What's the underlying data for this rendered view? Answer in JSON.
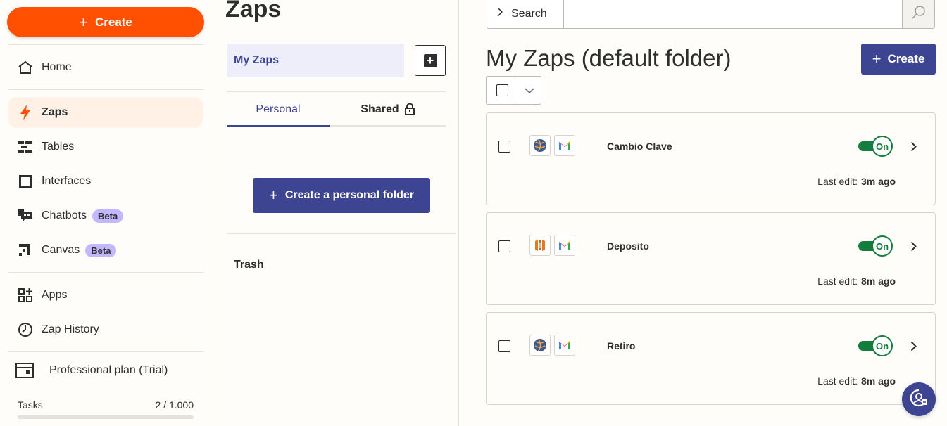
{
  "sidebar": {
    "create_label": "Create",
    "nav_primary": [
      {
        "label": "Home",
        "icon": "home-icon"
      }
    ],
    "nav_main": [
      {
        "label": "Zaps",
        "icon": "bolt-icon",
        "active": true
      },
      {
        "label": "Tables",
        "icon": "tables-icon"
      },
      {
        "label": "Interfaces",
        "icon": "interfaces-icon"
      },
      {
        "label": "Chatbots",
        "icon": "chatbot-icon",
        "badge": "Beta"
      },
      {
        "label": "Canvas",
        "icon": "canvas-icon",
        "badge": "Beta"
      }
    ],
    "nav_secondary": [
      {
        "label": "Apps",
        "icon": "apps-icon"
      },
      {
        "label": "Zap History",
        "icon": "history-icon"
      }
    ],
    "plan_label": "Professional plan (Trial)",
    "tasks_label": "Tasks",
    "tasks_value": "2 / 1.000",
    "tasks_fraction": 0.002
  },
  "folders": {
    "title": "Zaps",
    "my_zaps_label": "My Zaps",
    "tabs": [
      {
        "label": "Personal",
        "active": true
      },
      {
        "label": "Shared",
        "icon": "lock-icon"
      }
    ],
    "create_folder_label": "Create a personal folder",
    "trash_label": "Trash"
  },
  "main": {
    "search_scope_label": "Search",
    "search_value": "",
    "title": "My Zaps (default folder)",
    "create_label": "Create",
    "zaps": [
      {
        "name": "Cambio Clave",
        "apps": [
          "globe-app-icon",
          "gmail-icon"
        ],
        "status": "On",
        "last_edit_label": "Last edit:",
        "last_edit_value": "3m ago"
      },
      {
        "name": "Deposito",
        "apps": [
          "aws-app-icon",
          "gmail-icon"
        ],
        "status": "On",
        "last_edit_label": "Last edit:",
        "last_edit_value": "8m ago"
      },
      {
        "name": "Retiro",
        "apps": [
          "globe-app-icon",
          "gmail-icon"
        ],
        "status": "On",
        "last_edit_label": "Last edit:",
        "last_edit_value": "8m ago"
      }
    ]
  },
  "colors": {
    "orange": "#ff4f00",
    "indigo": "#3d4592",
    "toggle_on": "#137e3c",
    "beta_badge": "#c3b7ff"
  }
}
